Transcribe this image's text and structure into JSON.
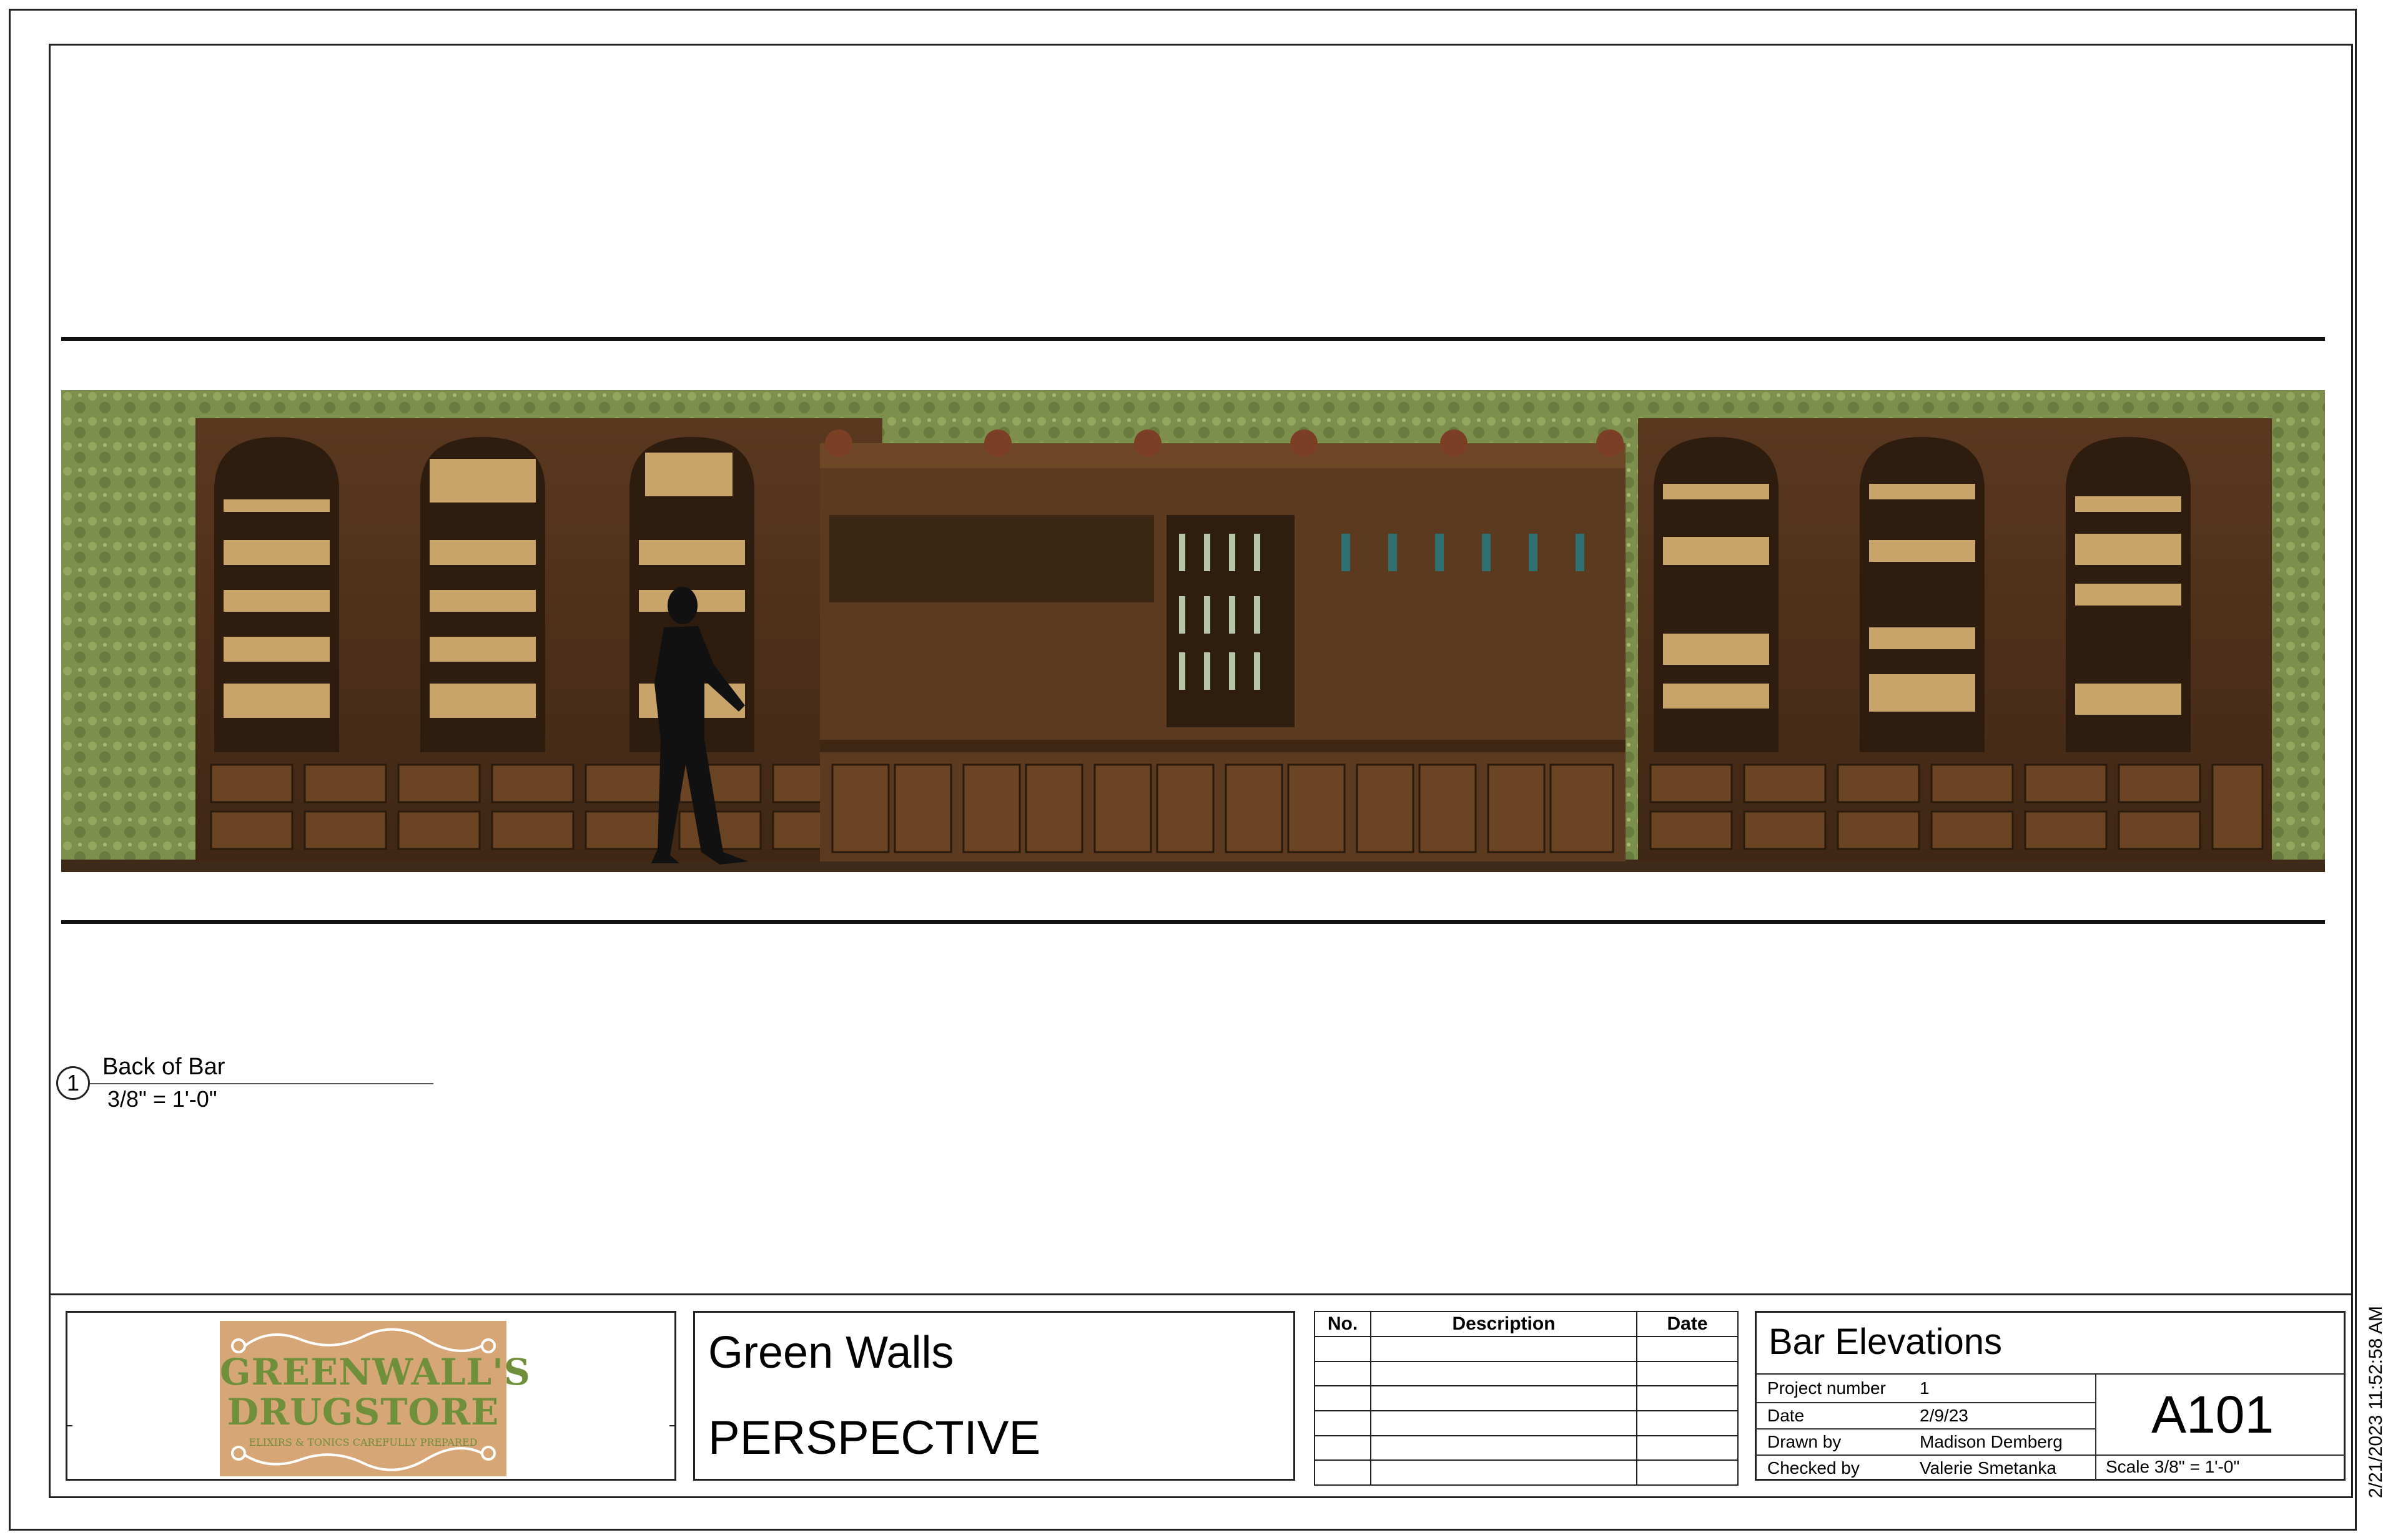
{
  "elevation": {
    "callout_number": "1",
    "title": "Back of Bar",
    "scale": "3/8\" = 1'-0\""
  },
  "logo": {
    "line1": "GREENWALL'S",
    "line2": "DRUGSTORE",
    "tagline": "ELIXIRS & TONICS CAREFULLY PREPARED"
  },
  "project": {
    "name": "Green Walls",
    "view": "PERSPECTIVE"
  },
  "revisions": {
    "headers": [
      "No.",
      "Description",
      "Date"
    ],
    "rows": 6
  },
  "sheet": {
    "title": "Bar Elevations",
    "fields": [
      {
        "label": "Project number",
        "value": "1"
      },
      {
        "label": "Date",
        "value": "2/9/23"
      },
      {
        "label": "Drawn by",
        "value": "Madison Demberg"
      },
      {
        "label": "Checked by",
        "value": "Valerie Smetanka"
      }
    ],
    "number": "A101",
    "scale": "Scale  3/8\" = 1'-0\""
  },
  "timestamp": "2/21/2023 11:52:58 AM",
  "colors": {
    "wallpaper": "#7c8f4c",
    "wood_dark": "#4a2e18",
    "wood_mid": "#6d4526",
    "wood_light": "#8a5a33",
    "logo_bg": "#d6a677",
    "logo_text": "#6f8f3a"
  }
}
